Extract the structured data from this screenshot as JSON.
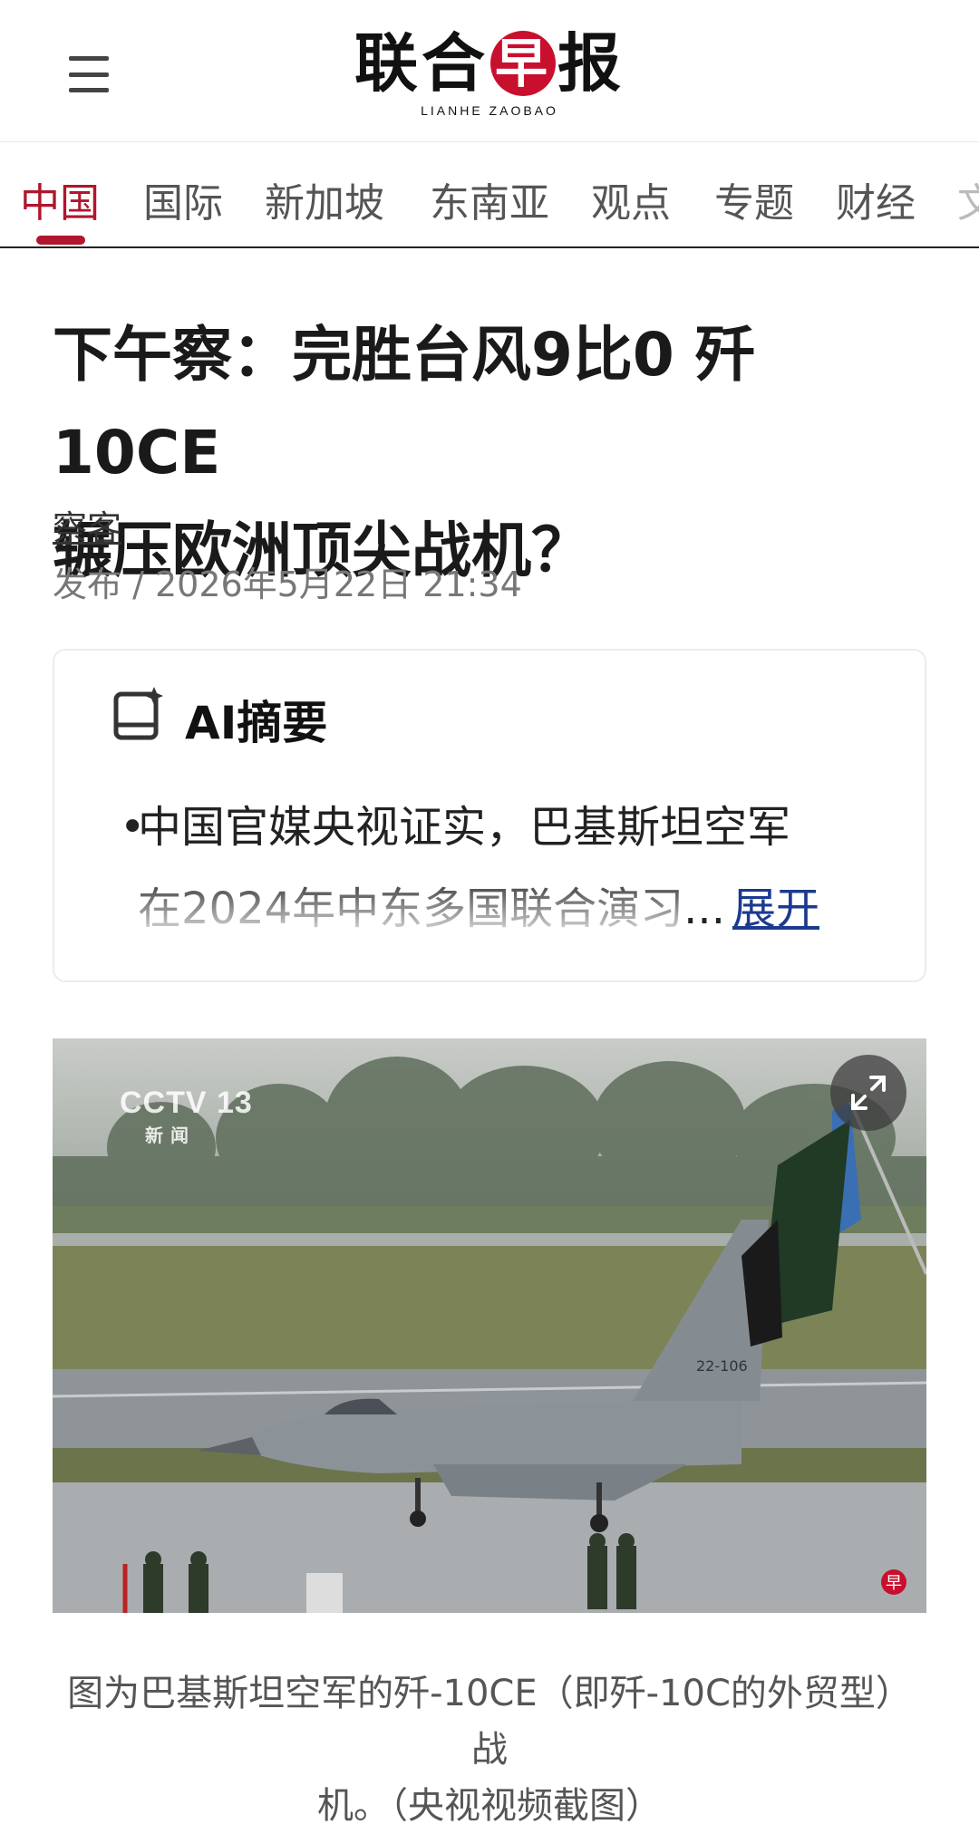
{
  "header": {
    "logo_cn_1": "联",
    "logo_cn_2": "合",
    "logo_cn_3": "早",
    "logo_cn_4": "报",
    "logo_en": "LIANHE ZAOBAO"
  },
  "nav": {
    "items": [
      {
        "label": "中国",
        "active": true
      },
      {
        "label": "国际",
        "active": false
      },
      {
        "label": "新加坡",
        "active": false
      },
      {
        "label": "东南亚",
        "active": false
      },
      {
        "label": "观点",
        "active": false
      },
      {
        "label": "专题",
        "active": false
      },
      {
        "label": "财经",
        "active": false
      },
      {
        "label": "文",
        "active": false
      }
    ]
  },
  "article": {
    "title_line1": "下午察：完胜台风9比0 歼10CE",
    "title_line2": "辗压欧洲顶尖战机？",
    "author": "察客",
    "meta": "发布 / 2026年5月22日 21:34"
  },
  "ai_summary": {
    "title": "AI摘要",
    "bullet_line1": "中国官媒央视证实，巴基斯坦空军",
    "bullet_line2": "在2024年中东多国联合演习",
    "ellipsis": "...",
    "expand_label": "展开"
  },
  "photo": {
    "channel_logo": "CCTV 13",
    "channel_sub": "新闻",
    "tail_number": "22-106",
    "watermark": "早"
  },
  "caption": {
    "line1": "图为巴基斯坦空军的歼-10CE（即歼-10C的外贸型）战",
    "line2": "机。（央视视频截图）"
  },
  "colors": {
    "brand_red": "#c8102e",
    "active_tab": "#b0162d",
    "link_blue": "#1b3a8f"
  }
}
